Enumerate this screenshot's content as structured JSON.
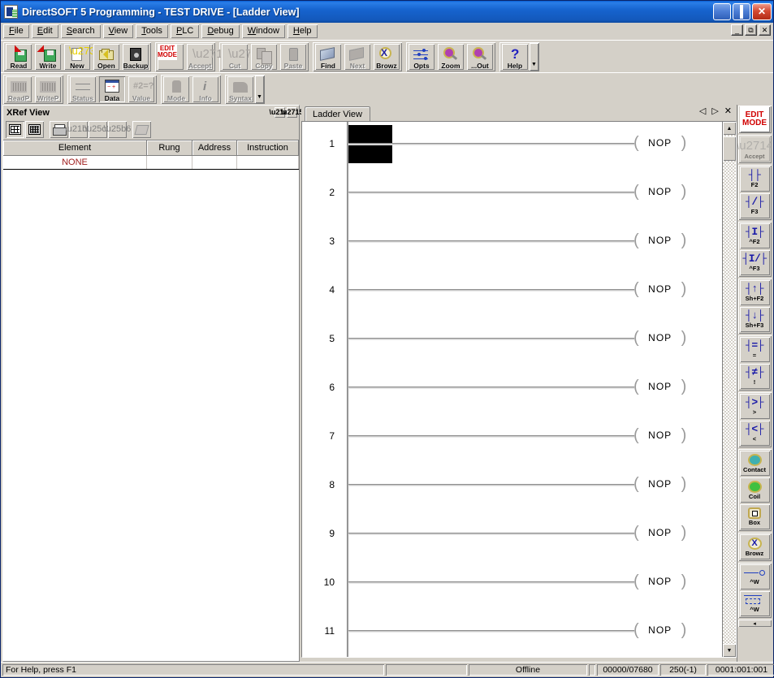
{
  "window": {
    "title": "DirectSOFT 5 Programming - TEST DRIVE - [Ladder View]",
    "icon": "app-icon",
    "minimize": "–",
    "maximize": "□",
    "close": "✕"
  },
  "mdi_buttons": {
    "minimize": "_",
    "restore": "⧉",
    "close": "✕"
  },
  "menu": [
    {
      "label": "File",
      "accel": "F"
    },
    {
      "label": "Edit",
      "accel": "E"
    },
    {
      "label": "Search",
      "accel": "S"
    },
    {
      "label": "View",
      "accel": "V"
    },
    {
      "label": "Tools",
      "accel": "T"
    },
    {
      "label": "PLC",
      "accel": "P"
    },
    {
      "label": "Debug",
      "accel": "D"
    },
    {
      "label": "Window",
      "accel": "W"
    },
    {
      "label": "Help",
      "accel": "H"
    }
  ],
  "toolbar_row1": {
    "groups": [
      {
        "buttons": [
          {
            "label": "Read",
            "icon": "read-project-icon",
            "enabled": true
          },
          {
            "label": "Write",
            "icon": "write-project-icon",
            "enabled": true
          },
          {
            "label": "New",
            "icon": "new-project-icon",
            "enabled": true
          },
          {
            "label": "Open",
            "icon": "open-project-icon",
            "enabled": true
          },
          {
            "label": "Backup",
            "icon": "backup-icon",
            "enabled": true
          }
        ]
      },
      {
        "buttons": [
          {
            "label": "EDIT MODE",
            "icon": "edit-mode-icon",
            "enabled": true
          },
          {
            "label": "Accept",
            "icon": "accept-icon",
            "enabled": false
          }
        ]
      },
      {
        "buttons": [
          {
            "label": "Cut",
            "icon": "cut-icon",
            "enabled": false
          },
          {
            "label": "Copy",
            "icon": "copy-icon",
            "enabled": false
          },
          {
            "label": "Paste",
            "icon": "paste-icon",
            "enabled": false
          }
        ]
      },
      {
        "buttons": [
          {
            "label": "Find",
            "icon": "find-icon",
            "enabled": true
          },
          {
            "label": "Next",
            "icon": "find-next-icon",
            "enabled": false
          },
          {
            "label": "Browz",
            "icon": "browse-icon",
            "enabled": true
          }
        ]
      },
      {
        "buttons": [
          {
            "label": "Opts",
            "icon": "options-icon",
            "enabled": true
          },
          {
            "label": "Zoom",
            "icon": "zoom-in-icon",
            "enabled": true
          },
          {
            "label": "...Out",
            "icon": "zoom-out-icon",
            "enabled": true
          }
        ]
      },
      {
        "buttons": [
          {
            "label": "Help",
            "icon": "help-icon",
            "enabled": true
          }
        ]
      }
    ],
    "overflow": "▼"
  },
  "toolbar_row2": {
    "groups": [
      {
        "buttons": [
          {
            "label": "ReadP",
            "icon": "read-plc-icon",
            "enabled": false
          },
          {
            "label": "WriteP",
            "icon": "write-plc-icon",
            "enabled": false
          }
        ]
      },
      {
        "buttons": [
          {
            "label": "Status",
            "icon": "status-icon",
            "enabled": false
          },
          {
            "label": "Data",
            "icon": "data-view-icon",
            "enabled": true,
            "pressed": true
          },
          {
            "label": "Value",
            "icon": "value-icon",
            "enabled": false
          }
        ]
      },
      {
        "buttons": [
          {
            "label": "Mode",
            "icon": "plc-mode-icon",
            "enabled": false
          },
          {
            "label": "Info",
            "icon": "plc-info-icon",
            "enabled": false
          }
        ]
      },
      {
        "buttons": [
          {
            "label": "Syntax",
            "icon": "syntax-check-icon",
            "enabled": false
          }
        ]
      }
    ],
    "overflow": "▼"
  },
  "xref": {
    "title": "XRef View",
    "pin_icon": "pushpin-icon",
    "close_icon": "close-icon",
    "toolbar": [
      {
        "name": "view-grid-sparse",
        "icon": "grid-sparse-icon",
        "state": "sunken"
      },
      {
        "name": "view-grid-dense",
        "icon": "grid-dense-icon",
        "state": "raised"
      },
      {
        "name": "print",
        "icon": "printer-icon",
        "state": "raised"
      },
      {
        "name": "goto",
        "icon": "goto-arrow-icon",
        "state": "disabled"
      },
      {
        "name": "previous",
        "icon": "previous-arrow-icon",
        "state": "disabled"
      },
      {
        "name": "next",
        "icon": "next-arrow-icon",
        "state": "disabled"
      },
      {
        "name": "stack",
        "icon": "stack-icon",
        "state": "disabled"
      }
    ],
    "columns": [
      "Element",
      "Rung",
      "Address",
      "Instruction"
    ],
    "rows": [
      {
        "element": "NONE",
        "rung": "",
        "address": "",
        "instruction": ""
      }
    ]
  },
  "ladder": {
    "tab": "Ladder View",
    "tab_nav": {
      "prev": "◁",
      "next": "▷",
      "close": "✕"
    },
    "coil_open": "(",
    "coil_close": ")",
    "rungs": [
      {
        "number": "1",
        "instruction": "NOP",
        "cursor": true
      },
      {
        "number": "2",
        "instruction": "NOP",
        "cursor": false
      },
      {
        "number": "3",
        "instruction": "NOP",
        "cursor": false
      },
      {
        "number": "4",
        "instruction": "NOP",
        "cursor": false
      },
      {
        "number": "5",
        "instruction": "NOP",
        "cursor": false
      },
      {
        "number": "6",
        "instruction": "NOP",
        "cursor": false
      },
      {
        "number": "7",
        "instruction": "NOP",
        "cursor": false
      },
      {
        "number": "8",
        "instruction": "NOP",
        "cursor": false
      },
      {
        "number": "9",
        "instruction": "NOP",
        "cursor": false
      },
      {
        "number": "10",
        "instruction": "NOP",
        "cursor": false
      },
      {
        "number": "11",
        "instruction": "NOP",
        "cursor": false
      }
    ],
    "scroll_up": "▲",
    "scroll_down": "▼"
  },
  "palette": {
    "edit_mode": {
      "line1": "EDIT",
      "line2": "MODE"
    },
    "accept": {
      "label": "Accept",
      "icon": "accept-icon"
    },
    "instructions": [
      {
        "name": "normally-open-contact",
        "symbol": "┤├",
        "key": "F2"
      },
      {
        "name": "normally-closed-contact",
        "symbol": "┤/├",
        "key": "F3"
      },
      {
        "name": "not-contact-open",
        "symbol": "┤I├",
        "key": "^F2"
      },
      {
        "name": "not-contact-closed",
        "symbol": "┤I/├",
        "key": "^F3"
      },
      {
        "name": "rising-edge-contact",
        "symbol": "┤↑├",
        "key": "Sh+F2"
      },
      {
        "name": "falling-edge-contact",
        "symbol": "┤↓├",
        "key": "Sh+F3"
      },
      {
        "name": "compare-equal",
        "symbol": "┤=├",
        "key": "="
      },
      {
        "name": "compare-not-equal",
        "symbol": "┤≠├",
        "key": "!"
      },
      {
        "name": "compare-greater",
        "symbol": "┤>├",
        "key": ">"
      },
      {
        "name": "compare-less",
        "symbol": "┤<├",
        "key": "<"
      }
    ],
    "tools": [
      {
        "name": "contact-browser",
        "label": "Contact",
        "icon": "contact-icon"
      },
      {
        "name": "coil-browser",
        "label": "Coil",
        "icon": "coil-icon"
      },
      {
        "name": "box-browser",
        "label": "Box",
        "icon": "box-icon"
      },
      {
        "name": "element-browser",
        "label": "Browz",
        "icon": "browse-icon"
      }
    ],
    "wires": [
      {
        "name": "wire-horizontal",
        "label": "^W",
        "icon": "wire-icon"
      },
      {
        "name": "wire-branch",
        "label": "^W",
        "icon": "wire-branch-icon"
      }
    ],
    "scroll_more": "◂"
  },
  "statusbar": {
    "help": "For Help, press F1",
    "blank1": "",
    "mode": "Offline",
    "blank2": "",
    "memory": "00000/07680",
    "address": "250(-1)",
    "position": "0001:001:001"
  }
}
